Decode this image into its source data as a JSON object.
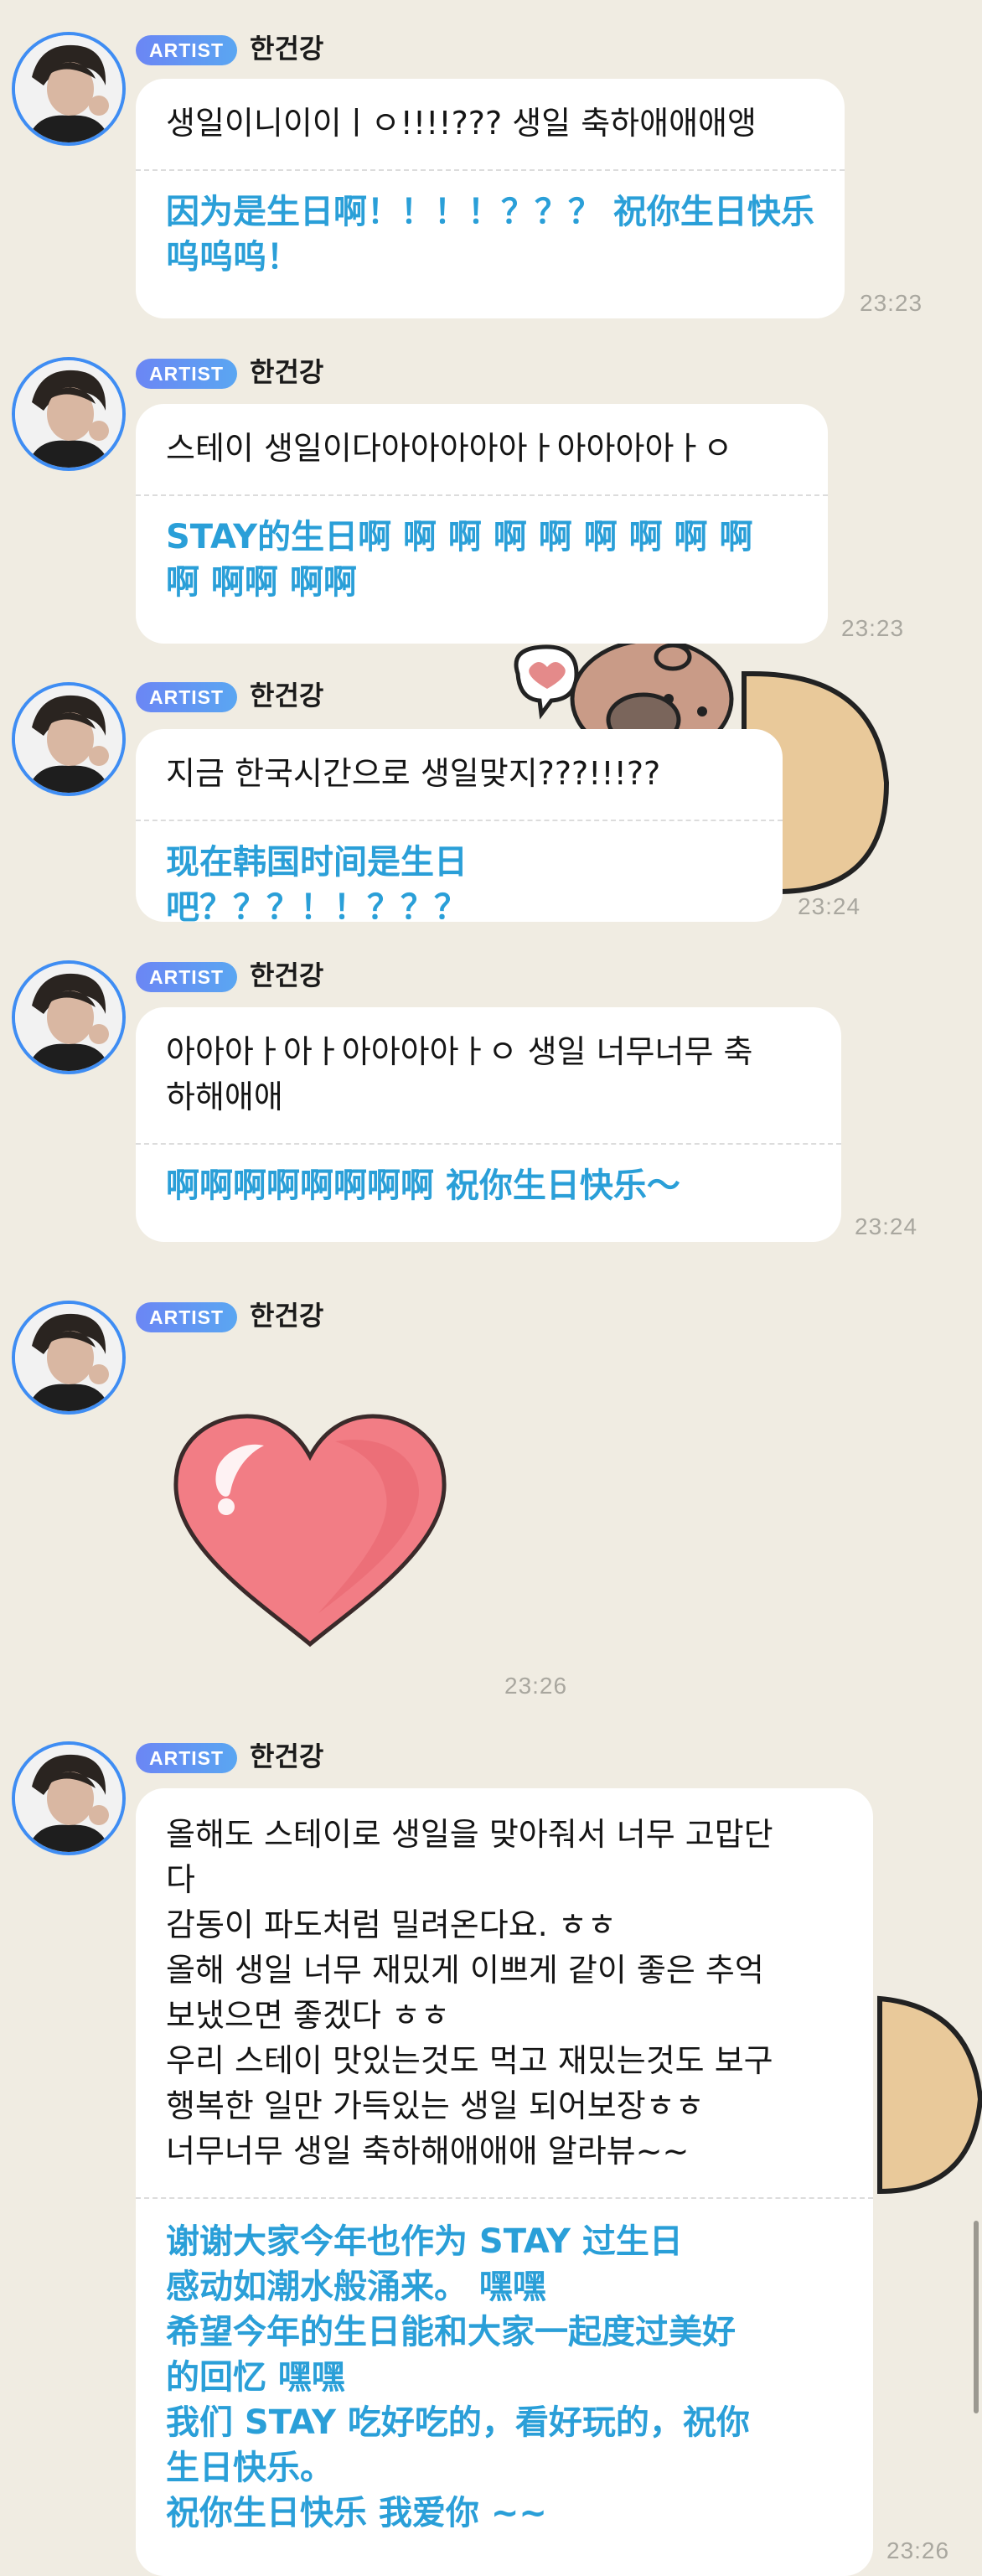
{
  "messages": [
    {
      "badge": "ARTIST",
      "sender": "한건강",
      "text_ko": "생일이니이이ㅣㅇ!!!!??? 생일 축하애애애앵",
      "text_zh": "因为是生日啊！！！！？？？ 祝你生日快乐\n呜呜呜！",
      "time": "23:23"
    },
    {
      "badge": "ARTIST",
      "sender": "한건강",
      "text_ko": "스테이 생일이다아아아아아ㅏ아아아아ㅏㅇ",
      "text_zh": "STAY的生日啊 啊 啊 啊 啊 啊 啊 啊 啊\n啊 啊啊 啊啊",
      "time": "23:23"
    },
    {
      "badge": "ARTIST",
      "sender": "한건강",
      "text_ko": "지금 한국시간으로 생일맞지???!!!??",
      "text_zh": "现在韩国时间是生日吧？？？！！？？？",
      "time": "23:24"
    },
    {
      "badge": "ARTIST",
      "sender": "한건강",
      "text_ko": "아아아ㅏ아ㅏ아아아아ㅏㅇ 생일 너무너무 축\n하해애애",
      "text_zh": "啊啊啊啊啊啊啊啊 祝你生日快乐～",
      "time": "23:24"
    },
    {
      "badge": "ARTIST",
      "sender": "한건강",
      "sticker": "heart-sticker",
      "time": "23:26"
    },
    {
      "badge": "ARTIST",
      "sender": "한건강",
      "text_ko": "올해도 스테이로 생일을 맞아줘서 너무 고맙단\n다\n감동이 파도처럼 밀려온다요. ㅎㅎ\n올해 생일 너무 재밌게 이쁘게 같이 좋은 추억\n보냈으면 좋겠다 ㅎㅎ\n우리 스테이 맛있는것도 먹고 재밌는것도 보구\n행복한 일만 가득있는 생일 되어보장ㅎㅎ\n너무너무 생일 축하해애애애 알라뷰~~",
      "text_zh": "谢谢大家今年也作为 STAY 过生日\n感动如潮水般涌来。 嘿嘿\n希望今年的生日能和大家一起度过美好\n的回忆 嘿嘿\n我们 STAY 吃好吃的，看好玩的，祝你\n生日快乐。\n祝你生日快乐 我爱你 ~~",
      "time": "23:26"
    }
  ],
  "colors": {
    "background": "#f0ece2",
    "bubble": "#ffffff",
    "translation_text": "#2a9fd8",
    "badge": "#6b86f4",
    "avatar_ring": "#3f8df3",
    "time_text": "#a9a79f"
  }
}
